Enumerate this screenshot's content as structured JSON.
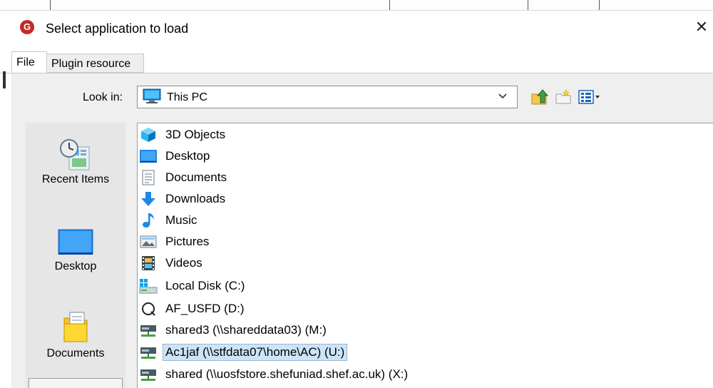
{
  "dialog": {
    "title": "Select application to load",
    "close_glyph": "✕"
  },
  "tabs": [
    {
      "label": "File",
      "active": true
    },
    {
      "label": "Plugin resource",
      "active": false
    }
  ],
  "look_in": {
    "label": "Look in:",
    "value": "This PC",
    "icon": "computer-icon"
  },
  "toolbar": {
    "up_icon": "up-one-level-icon",
    "new_folder_icon": "new-folder-icon",
    "view_icon": "view-menu-icon"
  },
  "places": [
    {
      "label": "Recent Items",
      "icon": "recent-items-icon"
    },
    {
      "label": "Desktop",
      "icon": "desktop-icon"
    },
    {
      "label": "Documents",
      "icon": "documents-icon"
    }
  ],
  "files": [
    {
      "label": "3D Objects",
      "icon": "3d-objects-icon",
      "selected": false
    },
    {
      "label": "Desktop",
      "icon": "desktop-icon",
      "selected": false
    },
    {
      "label": "Documents",
      "icon": "documents-icon",
      "selected": false
    },
    {
      "label": "Downloads",
      "icon": "downloads-icon",
      "selected": false
    },
    {
      "label": "Music",
      "icon": "music-icon",
      "selected": false
    },
    {
      "label": "Pictures",
      "icon": "pictures-icon",
      "selected": false
    },
    {
      "label": "Videos",
      "icon": "videos-icon",
      "selected": false
    },
    {
      "label": "Local Disk (C:)",
      "icon": "local-disk-icon",
      "selected": false
    },
    {
      "label": "AF_USFD (D:)",
      "icon": "optical-drive-icon",
      "selected": false
    },
    {
      "label": "shared3 (\\\\shareddata03) (M:)",
      "icon": "network-drive-icon",
      "selected": false
    },
    {
      "label": "Ac1jaf (\\\\stfdata07\\home\\AC) (U:)",
      "icon": "network-drive-icon",
      "selected": true
    },
    {
      "label": "shared (\\\\uosfstore.shefuniad.shef.ac.uk) (X:)",
      "icon": "network-drive-icon",
      "selected": false
    }
  ],
  "colors": {
    "selection": "#cce4f7",
    "app_icon": "#c62828",
    "panel_bg": "#efefef"
  }
}
